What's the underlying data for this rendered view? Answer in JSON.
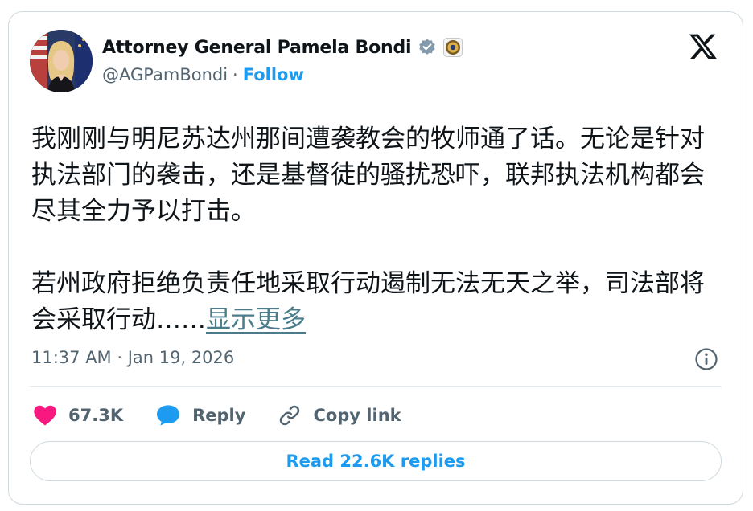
{
  "author": {
    "display_name": "Attorney General Pamela Bondi",
    "handle": "@AGPamBondi",
    "separator": "·",
    "follow_label": "Follow"
  },
  "tweet": {
    "paragraph_1": "我刚刚与明尼苏达州那间遭袭教会的牧师通了话。无论是针对执法部门的袭击，还是基督徒的骚扰恐吓，联邦执法机构都会尽其全力予以打击。",
    "paragraph_2": "若州政府拒绝负责任地采取行动遏制无法无天之举，司法部将会采取行动……",
    "show_more_label": "显示更多"
  },
  "meta": {
    "timestamp": "11:37 AM · Jan 19, 2026"
  },
  "actions": {
    "likes": "67.3K",
    "reply_label": "Reply",
    "copy_link_label": "Copy link"
  },
  "read_replies_label": "Read 22.6K replies",
  "colors": {
    "accent_blue": "#1d9bf0",
    "like_pink": "#f91880",
    "text_primary": "#0f1419",
    "text_secondary": "#536471",
    "show_more": "#4a7c8c"
  },
  "icons": {
    "verified": "verified-badge-icon",
    "affiliate": "doj-seal-icon",
    "logo": "x-logo-icon",
    "info": "info-icon",
    "like": "heart-icon",
    "reply": "speech-bubble-icon",
    "copy_link": "link-icon"
  }
}
